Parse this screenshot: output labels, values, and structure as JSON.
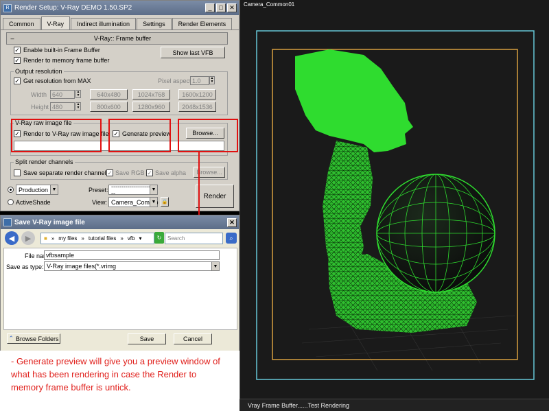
{
  "render_setup": {
    "title": "Render Setup: V-Ray DEMO 1.50.SP2",
    "title_icon": "R",
    "window_buttons": [
      "_",
      "□",
      "✕"
    ],
    "tabs": [
      "Common",
      "V-Ray",
      "Indirect illumination",
      "Settings",
      "Render Elements"
    ],
    "rollout_minus": "–",
    "rollout_title": "V-Ray:: Frame buffer",
    "enable_vfb": "Enable built-in Frame Buffer",
    "render_memory": "Render to memory frame buffer",
    "show_last_vfb": "Show last VFB",
    "output_group": "Output resolution",
    "get_from_max": "Get resolution from MAX",
    "pixel_aspect_label": "Pixel aspect:",
    "pixel_aspect_value": "1.0",
    "width_label": "Width",
    "width_value": "640",
    "height_label": "Height",
    "height_value": "480",
    "presets": [
      "640x480",
      "1024x768",
      "1600x1200",
      "800x600",
      "1280x960",
      "2048x1536"
    ],
    "raw_group": "V-Ray raw image file",
    "render_raw": "Render to V-Ray raw image file",
    "generate_preview": "Generate preview",
    "browse": "Browse...",
    "split_group": "Split render channels",
    "save_separate": "Save separate render channels",
    "save_rgb": "Save RGB",
    "save_alpha": "Save alpha",
    "browse2": "Browse...",
    "production": "Production",
    "activeshade": "ActiveShade",
    "preset_label": "Preset:",
    "preset_value": "------------------------",
    "view_label": "View:",
    "view_value": "Camera_Commo",
    "render_btn": "Render",
    "check_mark": "✓"
  },
  "save_dialog": {
    "title": "Save V-Ray image file",
    "crumbs": [
      "»",
      "my files",
      "»",
      "tutorial files",
      "»",
      "vfb",
      "▾"
    ],
    "search_placeholder": "Search",
    "file_name_label": "File name:",
    "file_name_value": "vfbsample",
    "save_type_label": "Save as type:",
    "save_type_value": "V-Ray image files(*.vrimg",
    "browse_folders": "Browse Folders",
    "save": "Save",
    "cancel": "Cancel"
  },
  "annotation": "- Generate preview will give you a preview window of what has been rendering in case the Render to memory frame buffer is untick.",
  "viewport": {
    "label": "Camera_Common01",
    "status": "Vray Frame Buffer......Test Rendering"
  },
  "colors": {
    "wire": "#22cc22",
    "safe_frame_outer": "#66c8d8",
    "safe_frame_inner": "#d8a040",
    "highlight_red": "#e01010"
  }
}
